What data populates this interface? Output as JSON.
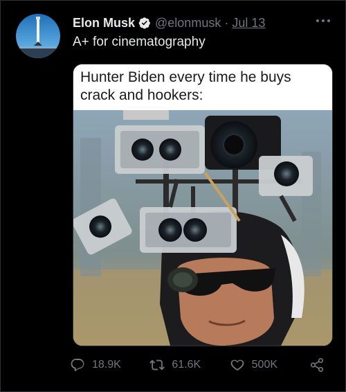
{
  "tweet": {
    "author_name": "Elon Musk",
    "handle": "@elonmusk",
    "separator": "·",
    "date": "Jul 13",
    "text": "A+ for cinematography"
  },
  "media": {
    "caption": "Hunter Biden every time he buys crack and hookers:"
  },
  "actions": {
    "replies": "18.9K",
    "retweets": "61.6K",
    "likes": "500K"
  },
  "icons": {
    "verified": "verified-badge-icon",
    "more": "more-options-icon",
    "reply": "reply-icon",
    "retweet": "retweet-icon",
    "like": "heart-icon",
    "share": "share-icon"
  },
  "colors": {
    "background": "#000000",
    "text_primary": "#e7e9ea",
    "text_secondary": "#71767b",
    "border": "#2f3336"
  }
}
